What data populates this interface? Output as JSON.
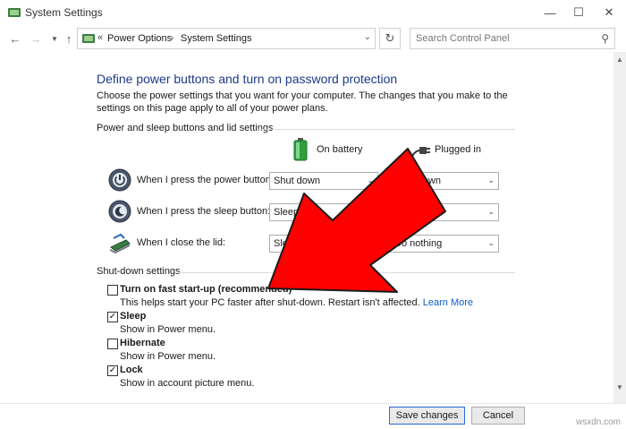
{
  "window": {
    "title": "System Settings"
  },
  "nav": {
    "back_icon": "arrow-left-icon",
    "forward_icon": "arrow-right-icon",
    "up_icon": "arrow-up-icon",
    "breadcrumb": [
      "Power Options",
      "System Settings"
    ],
    "search_placeholder": "Search Control Panel"
  },
  "page": {
    "heading": "Define power buttons and turn on password protection",
    "description": "Choose the power settings that you want for your computer. The changes that you make to the settings on this page apply to all of your power plans."
  },
  "power_section": {
    "label": "Power and sleep buttons and lid settings",
    "columns": [
      "On battery",
      "Plugged in"
    ],
    "rows": [
      {
        "label": "When I press the power button:",
        "battery": "Shut down",
        "plugged": "Shut down"
      },
      {
        "label": "When I press the sleep button:",
        "battery": "Sleep",
        "plugged": "Sleep"
      },
      {
        "label": "When I close the lid:",
        "battery": "Sleep",
        "plugged": "Do nothing"
      }
    ]
  },
  "shutdown_section": {
    "label": "Shut-down settings",
    "items": [
      {
        "label": "Turn on fast start-up (recommended)",
        "checked": false,
        "description": "This helps start your PC faster after shut-down. Restart isn't affected.",
        "link": "Learn More"
      },
      {
        "label": "Sleep",
        "checked": true,
        "description": "Show in Power menu."
      },
      {
        "label": "Hibernate",
        "checked": false,
        "description": "Show in Power menu."
      },
      {
        "label": "Lock",
        "checked": true,
        "description": "Show in account picture menu."
      }
    ]
  },
  "footer": {
    "save_label": "Save changes",
    "cancel_label": "Cancel"
  },
  "watermark": "wsxdn.com",
  "colors": {
    "heading": "#1e3a8a",
    "link": "#0b5fc7",
    "arrow": "#ff0000"
  }
}
